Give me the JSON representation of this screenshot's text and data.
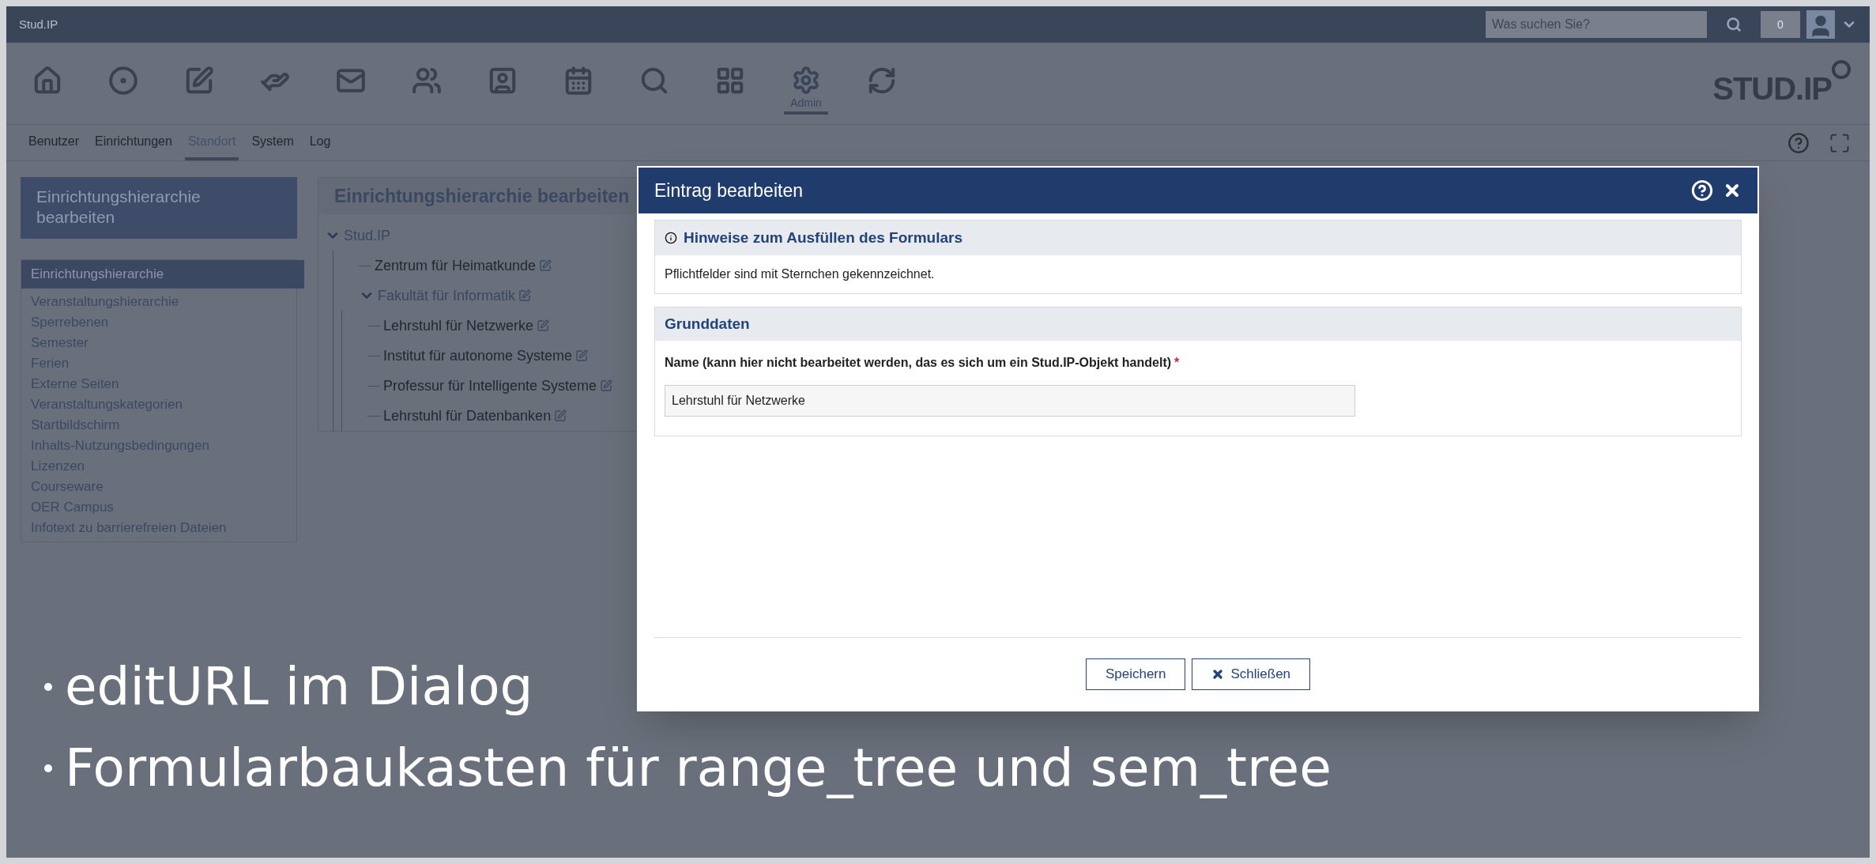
{
  "top_bar": {
    "brand": "Stud.IP",
    "search": {
      "placeholder": "Was suchen Sie?"
    },
    "notification_count": "0"
  },
  "nav_icons": [
    {
      "kind": "home",
      "selected": false
    },
    {
      "kind": "activity",
      "selected": false
    },
    {
      "kind": "courses",
      "selected": false
    },
    {
      "kind": "messages",
      "selected": false
    },
    {
      "kind": "mail",
      "selected": false
    },
    {
      "kind": "community",
      "selected": false
    },
    {
      "kind": "profile",
      "selected": false
    },
    {
      "kind": "calendar",
      "selected": false
    },
    {
      "kind": "search",
      "selected": false
    },
    {
      "kind": "tools",
      "selected": false
    },
    {
      "kind": "admin",
      "label": "Admin",
      "selected": true
    },
    {
      "kind": "assistant",
      "selected": false
    }
  ],
  "logo": "STUD.IP",
  "subnav": [
    {
      "label": "Benutzer",
      "selected": false
    },
    {
      "label": "Einrichtungen",
      "selected": false
    },
    {
      "label": "Standort",
      "selected": true
    },
    {
      "label": "System",
      "selected": false
    },
    {
      "label": "Log",
      "selected": false
    }
  ],
  "sidebar": {
    "title": "Einrichtungshierarchie bearbeiten",
    "items": [
      {
        "label": "Einrichtungshierarchie",
        "selected": true
      },
      {
        "label": "Veranstaltungshierarchie",
        "selected": false
      },
      {
        "label": "Sperrebenen",
        "selected": false
      },
      {
        "label": "Semester",
        "selected": false
      },
      {
        "label": "Ferien",
        "selected": false
      },
      {
        "label": "Externe Seiten",
        "selected": false
      },
      {
        "label": "Veranstaltungskategorien",
        "selected": false
      },
      {
        "label": "Startbildschirm",
        "selected": false
      },
      {
        "label": "Inhalts-Nutzungsbedingungen",
        "selected": false
      },
      {
        "label": "Lizenzen",
        "selected": false
      },
      {
        "label": "Courseware",
        "selected": false
      },
      {
        "label": "OER Campus",
        "selected": false
      },
      {
        "label": "Infotext zu barrierefreien Dateien",
        "selected": false
      }
    ]
  },
  "main": {
    "title": "Einrichtungshierarchie bearbeiten",
    "tree": [
      {
        "label": "Stud.IP",
        "expanded": true,
        "children": [
          {
            "label": "Zentrum für Heimatkunde",
            "editable": true
          },
          {
            "label": "Fakultät für Informatik",
            "expanded": true,
            "editable": true,
            "children": [
              {
                "label": "Lehrstuhl für Netzwerke",
                "editable": true
              },
              {
                "label": "Institut für autonome Systeme",
                "editable": true
              },
              {
                "label": "Professur für Intelligente Systeme",
                "editable": true
              },
              {
                "label": "Lehrstuhl für Datenbanken",
                "editable": true
              }
            ]
          }
        ]
      }
    ]
  },
  "dialog": {
    "title": "Eintrag bearbeiten",
    "info": {
      "title": "Hinweise zum Ausfüllen des Formulars",
      "text": "Pflichtfelder sind mit Sternchen gekennzeichnet."
    },
    "section": {
      "title": "Grunddaten",
      "field": {
        "label": "Name (kann hier nicht bearbeitet werden, das es sich um ein Stud.IP-Objekt handelt)",
        "required_mark": "*",
        "value": "Lehrstuhl für Netzwerke"
      }
    },
    "buttons": [
      {
        "kind": "save",
        "label": "Speichern"
      },
      {
        "kind": "close",
        "label": "Schließen"
      }
    ]
  },
  "slide_bullets": [
    "editURL im Dialog",
    "Formularbaukasten für range_tree und sem_tree"
  ]
}
